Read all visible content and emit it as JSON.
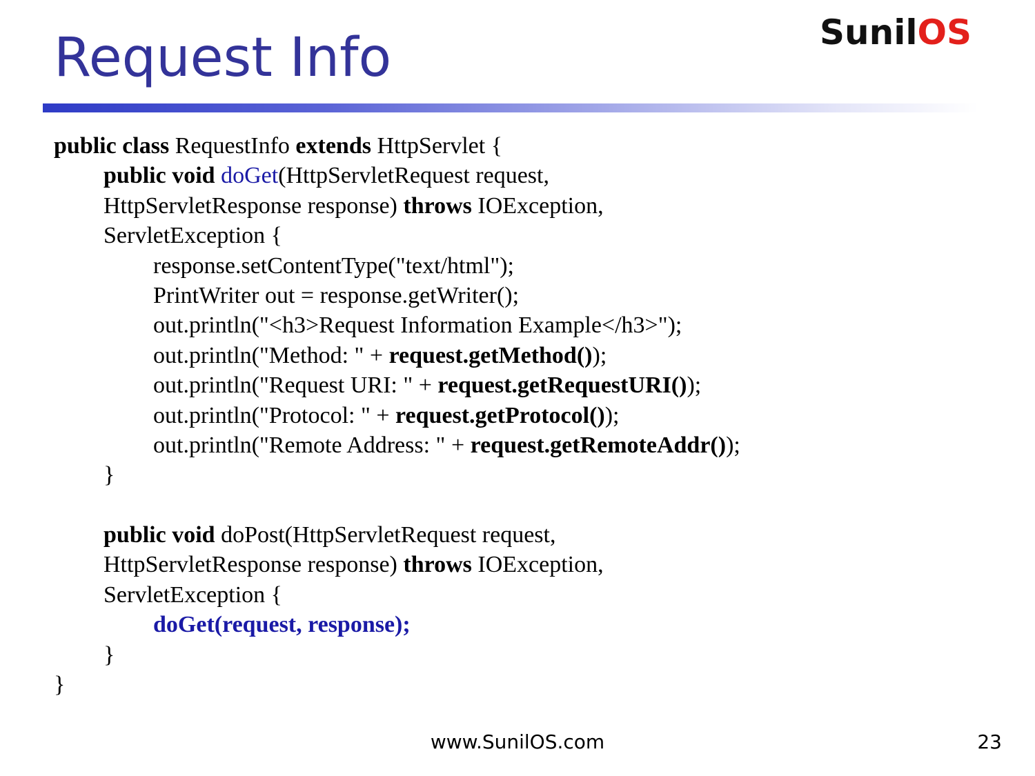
{
  "slide": {
    "title": "Request Info",
    "logo": {
      "part1": "Sunil",
      "part2": "OS",
      "colors": {
        "part1": "#111111",
        "part2": "#e3201b"
      }
    },
    "footer_url": "www.SunilOS.com",
    "page_number": "23",
    "title_color": "#333399",
    "accent_blue": "#1a1aa6"
  },
  "code": {
    "l1": [
      "public class",
      " RequestInfo ",
      "extends",
      " HttpServlet {"
    ],
    "l2": [
      "public void",
      " ",
      "doGet",
      "(HttpServletRequest request,"
    ],
    "l3": [
      "HttpServletResponse response) ",
      "throws",
      " IOException,"
    ],
    "l4": "ServletException {",
    "l5": "response.setContentType(\"text/html\");",
    "l6": "PrintWriter out = response.getWriter();",
    "l7": "out.println(\"<h3>Request Information Example</h3>\");",
    "l8": [
      "out.println(\"Method: \" + ",
      "request.getMethod()",
      ");"
    ],
    "l9": [
      "out.println(\"Request URI: \" + ",
      "request.getRequestURI()",
      ");"
    ],
    "l10": [
      "out.println(\"Protocol: \" + ",
      "request.getProtocol()",
      ");"
    ],
    "l11": [
      "out.println(\"Remote Address: \" + ",
      "request.getRemoteAddr()",
      ");"
    ],
    "l12": "}",
    "l13": "",
    "l14": [
      "public void",
      " doPost(HttpServletRequest request,"
    ],
    "l15": [
      "HttpServletResponse response) ",
      "throws",
      " IOException,"
    ],
    "l16": "ServletException {",
    "l17": "doGet(request, response);",
    "l18": "}",
    "l19": "}"
  }
}
